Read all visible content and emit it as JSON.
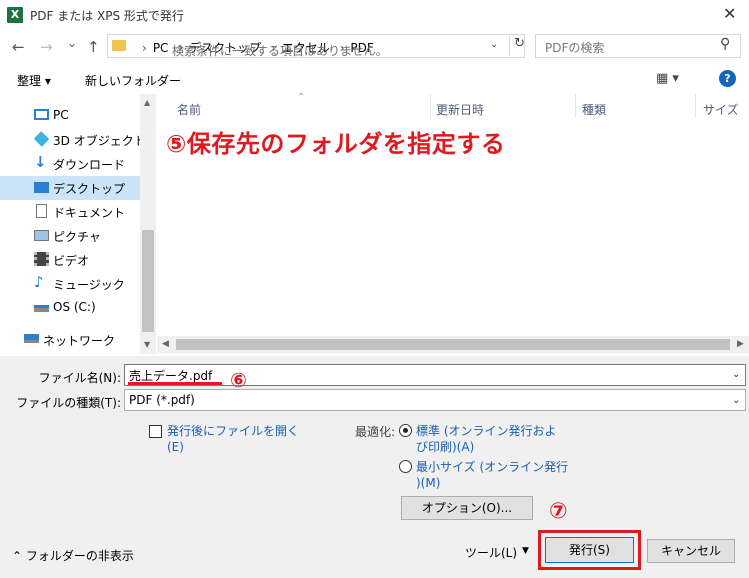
{
  "window": {
    "title": "PDF または XPS 形式で発行",
    "app_icon": "X",
    "close": "✕"
  },
  "nav_buttons": {
    "back": "←",
    "forward": "→",
    "recent": "⌄",
    "up": "↑"
  },
  "address": {
    "crumbs": [
      "PC",
      "デスクトップ",
      "エクセル",
      "PDF"
    ],
    "separator": "›"
  },
  "search": {
    "placeholder": "PDFの検索"
  },
  "toolbar": {
    "organize": "整理 ▾",
    "new_folder": "新しいフォルダー",
    "view_icon": "▦ ▾",
    "help": "?"
  },
  "nav_items": [
    {
      "label": "PC",
      "icon": "pc-icon"
    },
    {
      "label": "3D オブジェクト",
      "icon": "3d-objects-icon"
    },
    {
      "label": "ダウンロード",
      "icon": "download-icon"
    },
    {
      "label": "デスクトップ",
      "icon": "desktop-icon",
      "selected": true
    },
    {
      "label": "ドキュメント",
      "icon": "documents-icon"
    },
    {
      "label": "ピクチャ",
      "icon": "pictures-icon"
    },
    {
      "label": "ビデオ",
      "icon": "videos-icon"
    },
    {
      "label": "ミュージック",
      "icon": "music-icon"
    },
    {
      "label": "OS (C:)",
      "icon": "drive-icon"
    },
    {
      "label": "ネットワーク",
      "icon": "network-icon"
    }
  ],
  "columns": {
    "name": "名前",
    "modified": "更新日時",
    "type": "種類",
    "size": "サイズ"
  },
  "empty_message": "検索条件に一致する項目はありません。",
  "annotations": {
    "step5": "⑤保存先のフォルダを指定する",
    "step6": "⑥",
    "step7": "⑦"
  },
  "form": {
    "filename_label": "ファイル名(N):",
    "filename_value": "売上データ.pdf",
    "filetype_label": "ファイルの種類(T):",
    "filetype_value": "PDF (*.pdf)",
    "open_after_label_1": "発行後にファイルを開く",
    "open_after_label_2": "(E)",
    "optimize_label": "最適化:",
    "opt_standard_1": "標準 (オンライン発行およ",
    "opt_standard_2": "び印刷)(A)",
    "opt_min_1": "最小サイズ (オンライン発行",
    "opt_min_2": ")(M)",
    "options_button": "オプション(O)...",
    "tools": "ツール(L)",
    "publish_button": "発行(S)",
    "cancel_button": "キャンセル",
    "hide_folders": "フォルダーの非表示"
  },
  "colors": {
    "accent": "#0078d7",
    "annotation": "#e0191f",
    "selected": "#cce4f7"
  }
}
